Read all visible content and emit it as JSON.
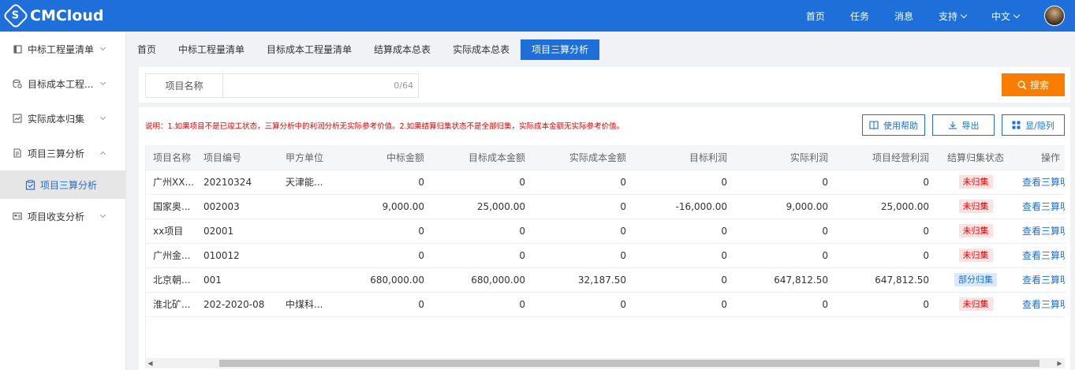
{
  "app": {
    "logo_text": "CMCloud",
    "logo_letter": "S"
  },
  "topnav": {
    "items": [
      "首页",
      "任务",
      "消息"
    ],
    "support": "支持",
    "language": "中文"
  },
  "sidebar": {
    "items": [
      {
        "label": "中标工程量清单"
      },
      {
        "label": "目标成本工程..."
      },
      {
        "label": "实际成本归集"
      },
      {
        "label": "项目三算分析"
      },
      {
        "label": "项目收支分析"
      }
    ],
    "active_sub": "项目三算分析"
  },
  "tabs": [
    "首页",
    "中标工程量清单",
    "目标成本工程量清单",
    "结算成本总表",
    "实际成本总表",
    "项目三算分析"
  ],
  "search": {
    "label": "项目名称",
    "value": "",
    "count": "0/64",
    "button": "搜索"
  },
  "note": "说明：1.如果项目不是已竣工状态，三算分析中的利润分析无实际参考价值。2.如果结算归集状态不是全部归集，实际成本金额无实际参考价值。",
  "actions": {
    "help": "使用帮助",
    "export": "导出",
    "columns": "显/隐列"
  },
  "table": {
    "headers": [
      "项目名称",
      "项目编号",
      "甲方单位",
      "中标金额",
      "目标成本金额",
      "实际成本金额",
      "目标利润",
      "实际利润",
      "项目经营利润",
      "结算归集状态",
      "操作"
    ],
    "rows": [
      [
        "广州XX...",
        "20210324",
        "天津能...",
        "0",
        "0",
        "0",
        "0",
        "0",
        "0",
        "未归集",
        "查看三算明细"
      ],
      [
        "国家奥...",
        "002003",
        "",
        "9,000.00",
        "25,000.00",
        "0",
        "-16,000.00",
        "9,000.00",
        "25,000.00",
        "未归集",
        "查看三算明细"
      ],
      [
        "xx项目",
        "02001",
        "",
        "0",
        "0",
        "0",
        "0",
        "0",
        "0",
        "未归集",
        "查看三算明细"
      ],
      [
        "广州金...",
        "010012",
        "",
        "0",
        "0",
        "0",
        "0",
        "0",
        "0",
        "未归集",
        "查看三算明细"
      ],
      [
        "北京朝...",
        "001",
        "",
        "680,000.00",
        "680,000.00",
        "32,187.50",
        "0",
        "647,812.50",
        "647,812.50",
        "部分归集",
        "查看三算明细"
      ],
      [
        "淮北矿...",
        "202-2020-08",
        "中煤科...",
        "0",
        "0",
        "0",
        "0",
        "0",
        "0",
        "未归集",
        "查看三算明细"
      ]
    ],
    "status_colors": {
      "未归集": "red",
      "部分归集": "blue"
    }
  },
  "colors": {
    "primary": "#1e6fd9",
    "accent": "#fa7d00",
    "danger": "#e60000"
  }
}
